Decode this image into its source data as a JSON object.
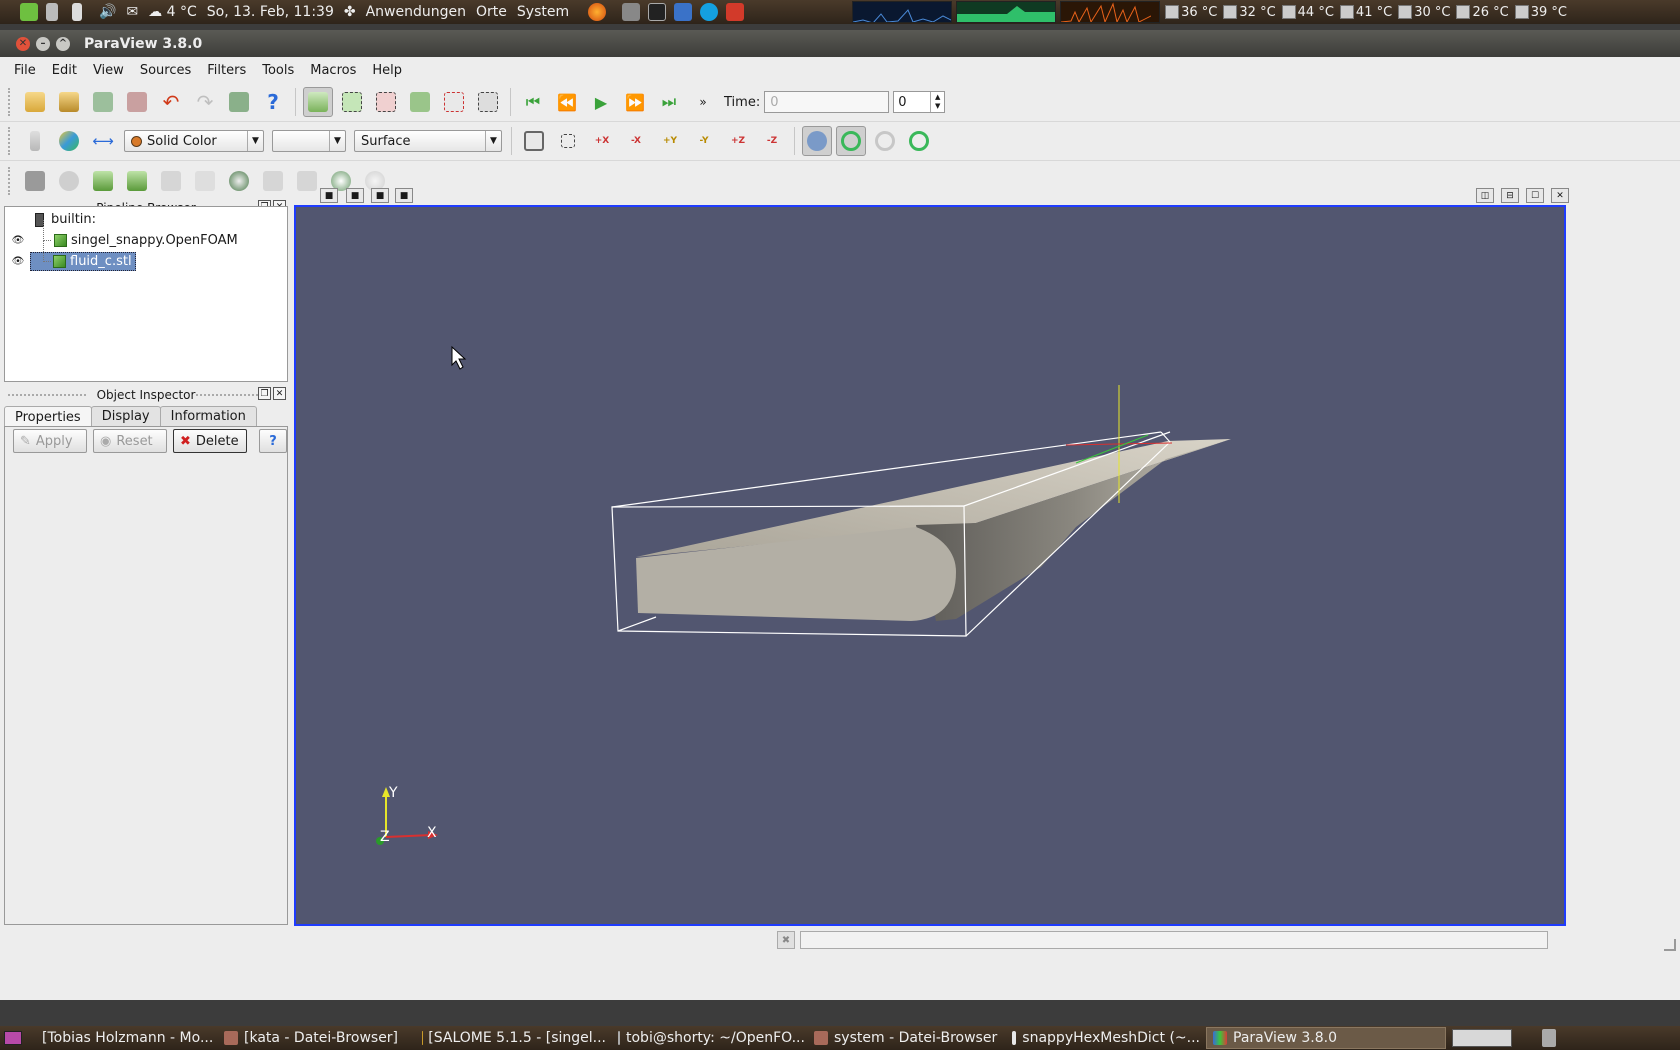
{
  "top_panel": {
    "weather": "4 °C",
    "datetime": "So, 13. Feb, 11:39",
    "menus": [
      "Anwendungen",
      "Orte",
      "System"
    ],
    "temperatures": [
      "36 °C",
      "32 °C",
      "44 °C",
      "41 °C",
      "30 °C",
      "26 °C",
      "39 °C"
    ]
  },
  "window": {
    "title": "ParaView 3.8.0"
  },
  "menubar": [
    "File",
    "Edit",
    "View",
    "Sources",
    "Filters",
    "Tools",
    "Macros",
    "Help"
  ],
  "toolbar1": {
    "time_label": "Time:",
    "time_value": "0",
    "time_index": "0"
  },
  "toolbar2": {
    "color_by": "Solid Color",
    "component": "",
    "representation": "Surface",
    "camera_buttons": [
      "+X",
      "-X",
      "+Y",
      "-Y",
      "+Z",
      "-Z"
    ]
  },
  "pipeline_browser": {
    "title": "Pipeline Browser",
    "root": "builtin:",
    "items": [
      {
        "label": "singel_snappy.OpenFOAM",
        "visible": true,
        "selected": false
      },
      {
        "label": "fluid_c.stl",
        "visible": true,
        "selected": true
      }
    ]
  },
  "object_inspector": {
    "title": "Object Inspector",
    "tabs": [
      "Properties",
      "Display",
      "Information"
    ],
    "active_tab": "Properties",
    "apply_label": "Apply",
    "reset_label": "Reset",
    "delete_label": "Delete",
    "help_label": "?"
  },
  "axes": {
    "x": "X",
    "y": "Y",
    "z": "Z"
  },
  "colors": {
    "viewport_bg": "#525670",
    "active_view_border": "#1f3cff",
    "selection": "#6e8fc2",
    "geometry": "#b3afa5"
  },
  "taskbar": [
    {
      "label": "[Tobias Holzmann - Mo...",
      "active": false
    },
    {
      "label": "[kata - Datei-Browser]",
      "active": false
    },
    {
      "label": "[SALOME 5.1.5 - [singel...",
      "active": false
    },
    {
      "label": "tobi@shorty: ~/OpenFO...",
      "active": false
    },
    {
      "label": "system - Datei-Browser",
      "active": false
    },
    {
      "label": "snappyHexMeshDict (~...",
      "active": false
    },
    {
      "label": "ParaView 3.8.0",
      "active": true
    }
  ]
}
